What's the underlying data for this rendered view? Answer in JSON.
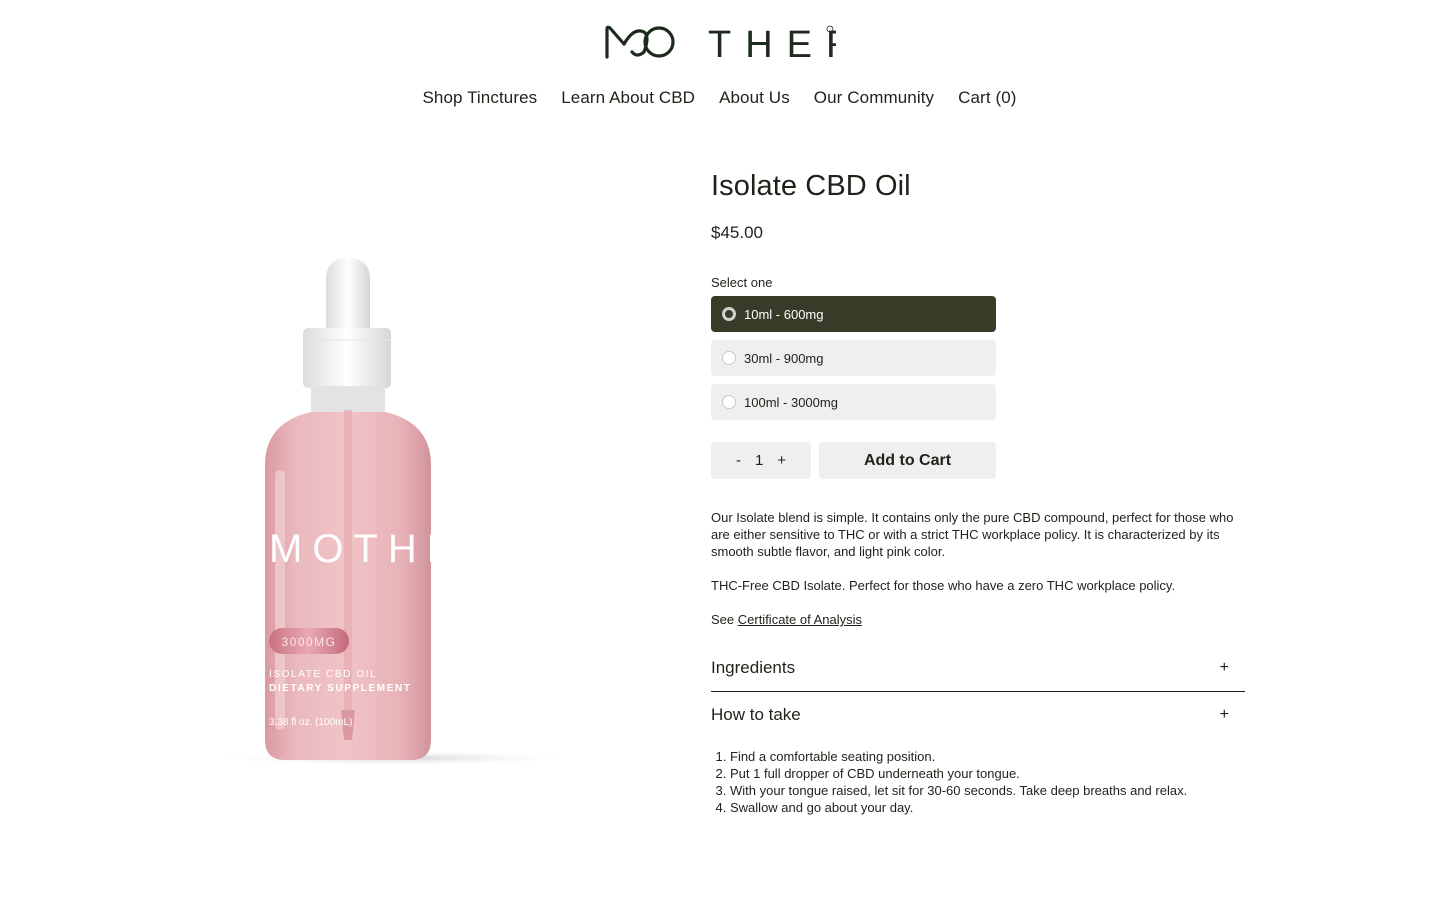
{
  "brand": {
    "logo_text": "MOTHER"
  },
  "nav": {
    "items": [
      {
        "label": "Shop Tinctures"
      },
      {
        "label": "Learn About CBD"
      },
      {
        "label": "About Us"
      },
      {
        "label": "Our Community"
      },
      {
        "label": "Cart (0)"
      }
    ]
  },
  "product": {
    "title": "Isolate CBD Oil",
    "price": "$45.00",
    "select_label": "Select one",
    "variants": [
      {
        "label": "10ml -  600mg",
        "selected": true
      },
      {
        "label": "30ml -  900mg",
        "selected": false
      },
      {
        "label": "100ml - 3000mg",
        "selected": false
      }
    ],
    "quantity": {
      "minus": "-",
      "value": "1",
      "plus": "+"
    },
    "add_to_cart_label": "Add to Cart",
    "description": [
      "Our Isolate blend is simple. It contains only the pure CBD compound, perfect for those who are either sensitive to THC or with a strict THC workplace policy. It is characterized by its smooth subtle flavor, and light pink color.",
      "THC-Free CBD Isolate. Perfect for those who have a zero THC workplace policy."
    ],
    "certificate": {
      "prefix": "See ",
      "link": "Certificate of Analysis"
    },
    "image": {
      "brand_text": "MOTHE",
      "badge": "3000MG",
      "line1": "ISOLATE CBD OIL",
      "line2": "DIETARY SUPPLEMENT",
      "volume": "3.38 fl oz. (100mL)"
    }
  },
  "accordion": {
    "ingredients": {
      "label": "Ingredients",
      "icon": "+"
    },
    "how_to_take": {
      "label": "How to take",
      "icon": "+"
    },
    "steps": [
      "Find a comfortable seating position.",
      "Put 1 full dropper of CBD underneath your tongue.",
      "With your tongue raised, let sit for 30-60 seconds. Take deep breaths and relax.",
      "Swallow and go about your day."
    ]
  },
  "colors": {
    "text": "#1d2319",
    "selected_variant_bg": "#3a3a28",
    "button_bg": "#efefef",
    "bottle_pink": "#e8b4b8"
  }
}
